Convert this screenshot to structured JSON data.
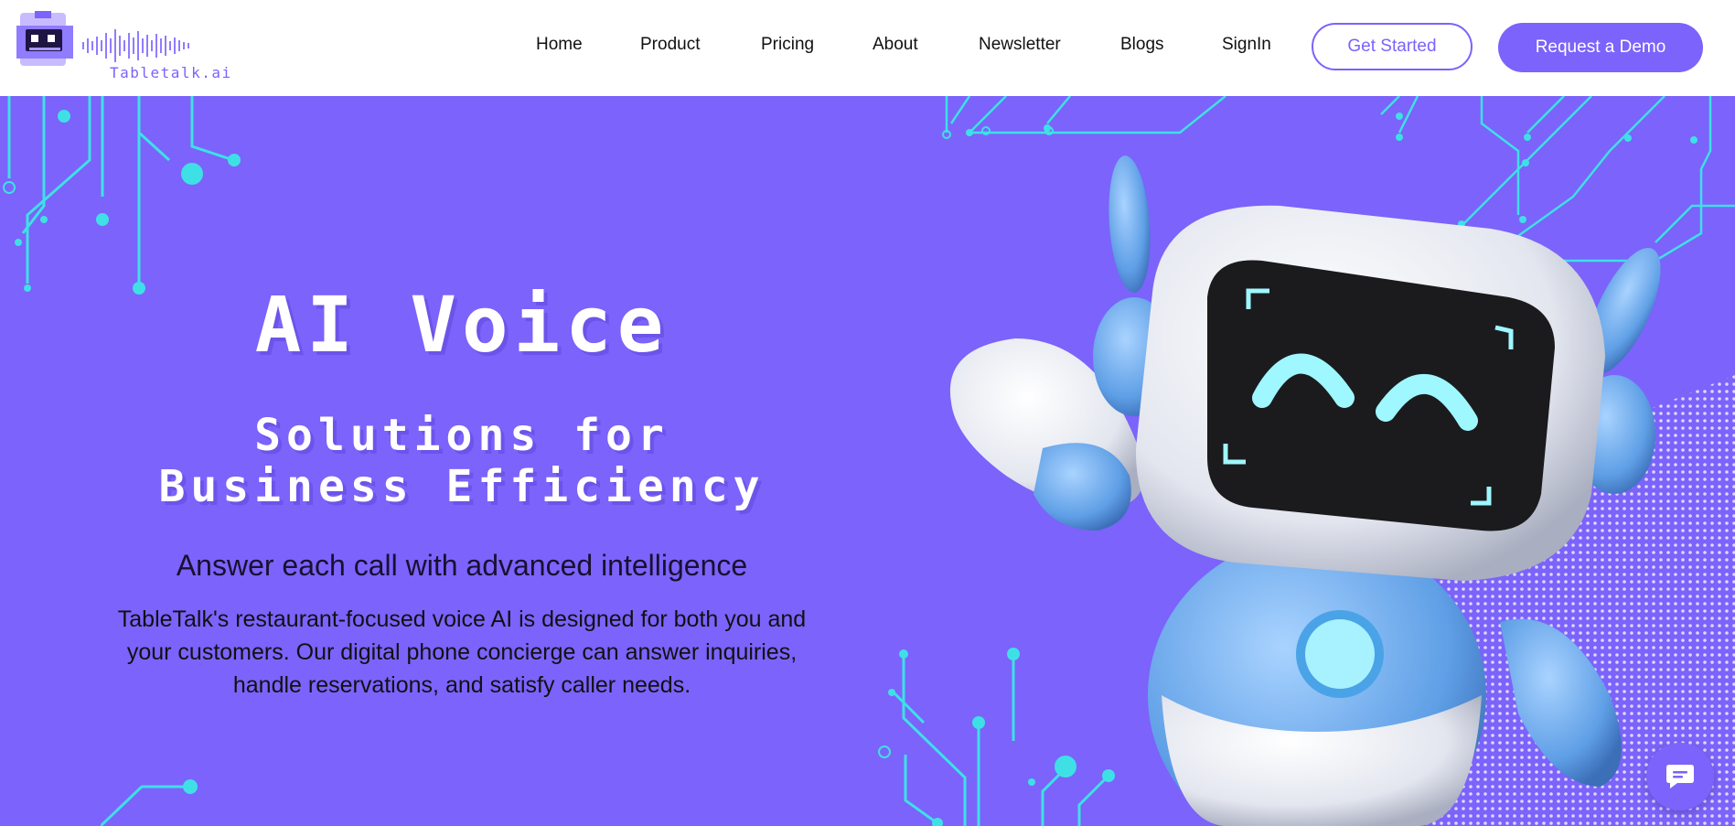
{
  "brand": {
    "name": "Tabletalk.ai"
  },
  "nav": {
    "items": [
      "Home",
      "Product",
      "Pricing",
      "About",
      "Newsletter",
      "Blogs",
      "SignIn"
    ],
    "get_started": "Get Started",
    "request_demo": "Request a Demo"
  },
  "hero": {
    "title": "AI Voice",
    "subtitle_line1": "Solutions for",
    "subtitle_line2": "Business Efficiency",
    "tagline": "Answer each call with advanced intelligence",
    "description": "TableTalk's restaurant-focused voice AI is designed for both you and your customers. Our digital phone concierge can answer inquiries, handle reservations, and satisfy caller needs."
  },
  "colors": {
    "accent": "#7b63fb",
    "circuit": "#3ee0e6",
    "header_bg": "#ffffff"
  },
  "icons": {
    "chat": "chat-bubble-icon",
    "logo": "robot-logo-icon"
  }
}
